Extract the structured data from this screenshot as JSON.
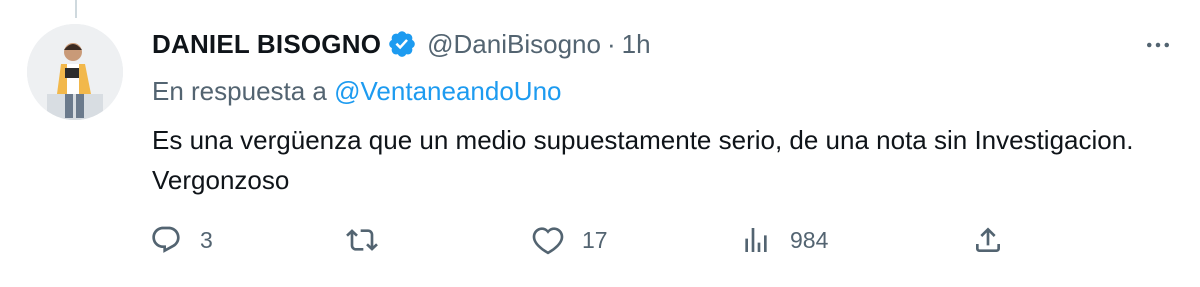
{
  "tweet": {
    "display_name": "DANIEL BISOGNO",
    "handle": "@DaniBisogno",
    "separator": "·",
    "time": "1h",
    "reply_prefix": "En respuesta a",
    "reply_to": "@VentaneandoUno",
    "text": "Es una vergüenza que un medio supuestamente serio, de una nota sin Investigacion. Vergonzoso"
  },
  "actions": {
    "reply_count": "3",
    "retweet_count": "",
    "like_count": "17",
    "views_count": "984"
  },
  "colors": {
    "text": "#0f1419",
    "secondary": "#536471",
    "accent": "#1d9bf0"
  },
  "icons": [
    "verified-badge-icon",
    "more-icon",
    "reply-icon",
    "retweet-icon",
    "like-icon",
    "views-icon",
    "share-icon"
  ]
}
